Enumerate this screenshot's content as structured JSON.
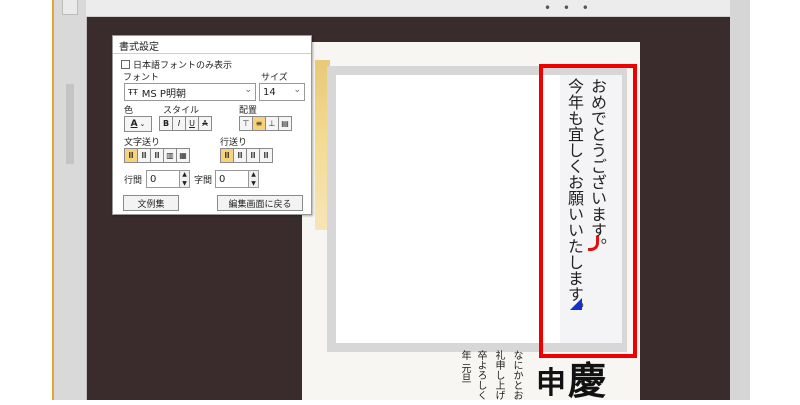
{
  "dialog": {
    "title": "書式設定",
    "jp_only_label": "日本語フォントのみ表示",
    "font_label": "フォント",
    "size_label": "サイズ",
    "font_value": "MS P明朝",
    "font_icon": "ŦŦ",
    "size_value": "14",
    "color_label": "色",
    "color_value": "A",
    "style_label": "スタイル",
    "style_buttons": [
      "B",
      "I",
      "U",
      "A"
    ],
    "align_label": "配置",
    "char_feed_label": "文字送り",
    "line_feed_label": "行送り",
    "line_spacing_label": "行間",
    "line_spacing_value": "0",
    "char_spacing_label": "字間",
    "char_spacing_value": "0",
    "examples_button": "文例集",
    "return_button": "編集画面に戻る"
  },
  "toolbar": {
    "dots": "• • •"
  },
  "card": {
    "line1": "おめでとうございます。",
    "line2": "今年も宜しくお願いいたします。",
    "small_lines": [
      "なにかとお",
      "礼申し上げ",
      "卒よろしく",
      "年 元旦"
    ],
    "brush_text_1": "慶",
    "brush_text_2": "申"
  },
  "colors": {
    "highlight": "#e00000",
    "accent": "#f7d27a",
    "background": "#3a2c2c"
  }
}
